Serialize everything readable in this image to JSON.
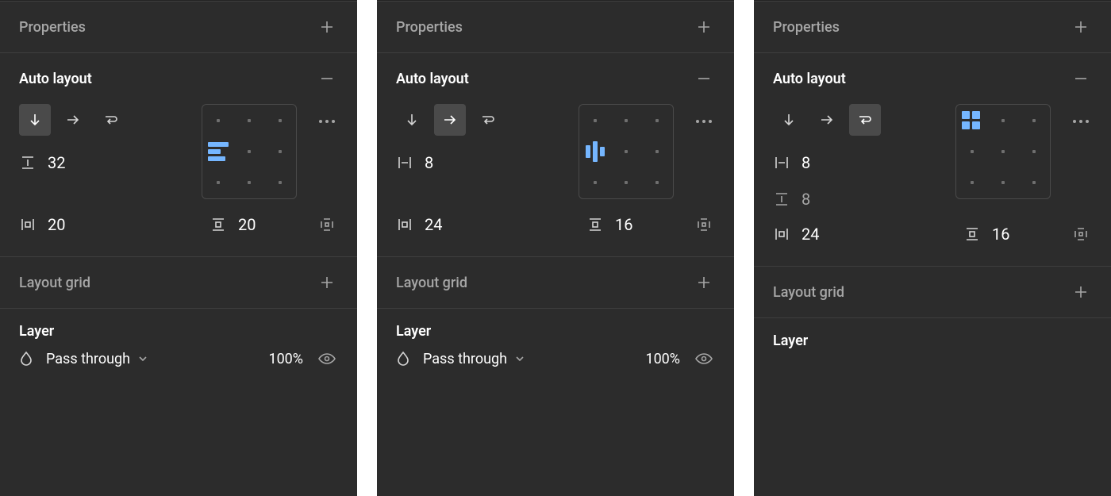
{
  "panels": [
    {
      "properties": {
        "title": "Properties"
      },
      "autolayout": {
        "title": "Auto layout",
        "direction": "vertical",
        "gap": "32",
        "row_gap": null,
        "pad_h": "20",
        "pad_v": "20"
      },
      "layoutgrid": {
        "title": "Layout grid"
      },
      "layer": {
        "title": "Layer",
        "blend": "Pass through",
        "opacity": "100%"
      }
    },
    {
      "properties": {
        "title": "Properties"
      },
      "autolayout": {
        "title": "Auto layout",
        "direction": "horizontal",
        "gap": "8",
        "row_gap": null,
        "pad_h": "24",
        "pad_v": "16"
      },
      "layoutgrid": {
        "title": "Layout grid"
      },
      "layer": {
        "title": "Layer",
        "blend": "Pass through",
        "opacity": "100%"
      }
    },
    {
      "properties": {
        "title": "Properties"
      },
      "autolayout": {
        "title": "Auto layout",
        "direction": "wrap",
        "gap": "8",
        "row_gap": "8",
        "pad_h": "24",
        "pad_v": "16"
      },
      "layoutgrid": {
        "title": "Layout grid"
      },
      "layer": {
        "title": "Layer",
        "blend": null,
        "opacity": null
      }
    }
  ]
}
